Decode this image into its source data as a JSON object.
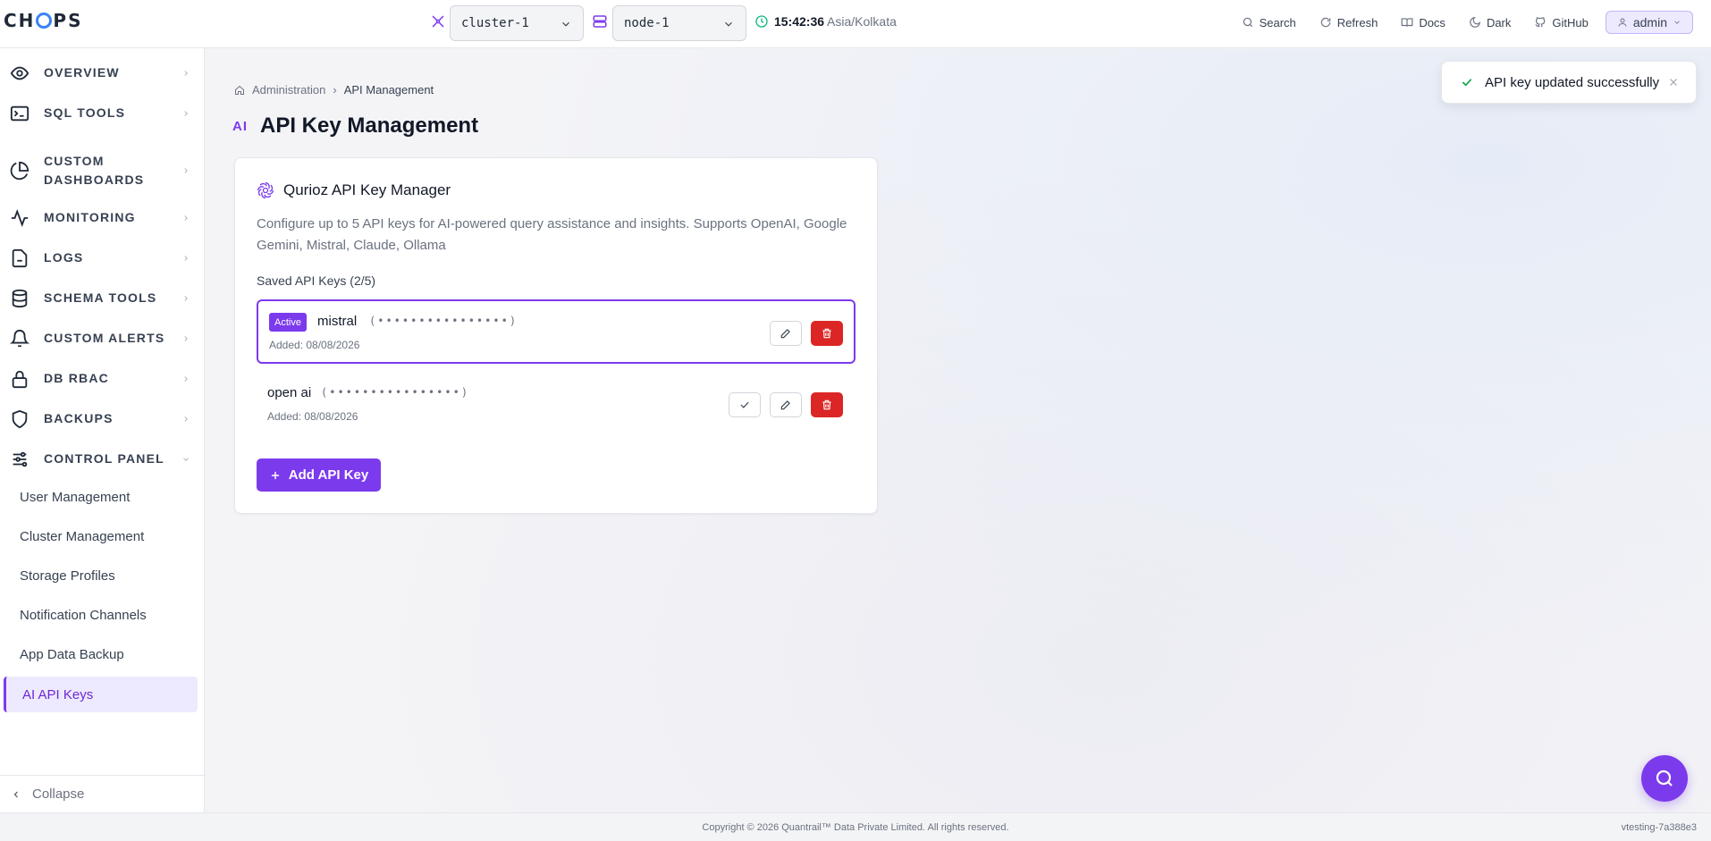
{
  "app": {
    "logo_text": "CHOPS",
    "accent": "#7c3aed"
  },
  "header": {
    "cluster_select": {
      "value": "cluster-1"
    },
    "node_select": {
      "value": "node-1"
    },
    "time": "15:42:36",
    "timezone": "Asia/Kolkata",
    "links": [
      {
        "label": "Search",
        "icon": "search-icon"
      },
      {
        "label": "Refresh",
        "icon": "refresh-icon"
      },
      {
        "label": "Docs",
        "icon": "book-icon"
      },
      {
        "label": "Dark",
        "icon": "moon-icon"
      },
      {
        "label": "GitHub",
        "icon": "github-icon"
      }
    ],
    "user": "admin"
  },
  "sidebar": {
    "items": [
      {
        "label": "OVERVIEW",
        "icon": "eye-icon"
      },
      {
        "label": "SQL TOOLS",
        "icon": "terminal-icon"
      },
      {
        "label": "CUSTOM DASHBOARDS",
        "icon": "pie-chart-icon"
      },
      {
        "label": "MONITORING",
        "icon": "activity-icon"
      },
      {
        "label": "LOGS",
        "icon": "file-icon"
      },
      {
        "label": "SCHEMA TOOLS",
        "icon": "database-icon"
      },
      {
        "label": "CUSTOM ALERTS",
        "icon": "bell-icon"
      },
      {
        "label": "DB RBAC",
        "icon": "lock-icon"
      },
      {
        "label": "BACKUPS",
        "icon": "shield-icon"
      },
      {
        "label": "CONTROL PANEL",
        "icon": "sliders-icon"
      }
    ],
    "sub_items": [
      {
        "label": "User Management"
      },
      {
        "label": "Cluster Management"
      },
      {
        "label": "Storage Profiles"
      },
      {
        "label": "Notification Channels"
      },
      {
        "label": "App Data Backup"
      },
      {
        "label": "AI API Keys",
        "active": true
      }
    ],
    "collapse_label": "Collapse"
  },
  "main": {
    "breadcrumb": {
      "parent": "Administration",
      "current": "API Management"
    },
    "title_badge": "AI",
    "title": "API Key Management",
    "card": {
      "title": "Qurioz API Key Manager",
      "description": "Configure up to 5 API keys for AI-powered query assistance and insights. Supports OpenAI, Google Gemini, Mistral, Claude, Ollama",
      "saved_label": "Saved API Keys (2/5)",
      "keys": [
        {
          "name": "mistral",
          "masked": "(••••••••••••••••)",
          "added": "Added: 08/08/2026",
          "active": true,
          "badge": "Active"
        },
        {
          "name": "open ai",
          "masked": "(••••••••••••••••)",
          "added": "Added: 08/08/2026",
          "active": false
        }
      ],
      "add_button": "Add API Key"
    }
  },
  "toast": {
    "message": "API key updated successfully"
  },
  "footer": {
    "copyright": "Copyright © 2026 Quantrail™ Data Private Limited. All rights reserved.",
    "version": "vtesting-7a388e3"
  }
}
